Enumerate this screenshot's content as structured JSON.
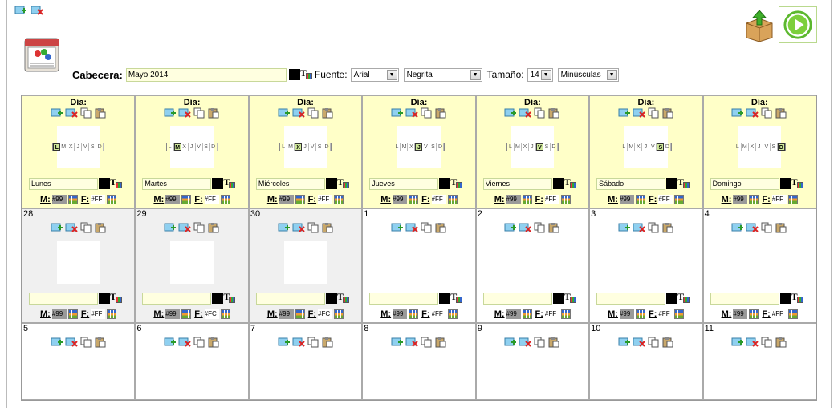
{
  "header": {
    "label": "Cabecera:",
    "value": "Mayo 2014",
    "font_label": "Fuente:",
    "font_family": "Arial",
    "font_weight": "Negrita",
    "size_label": "Tamaño:",
    "size_value": "14",
    "case_value": "Minúsculas"
  },
  "day_header_title": "Día:",
  "weekdays": [
    {
      "name": "Lunes",
      "letter": "L",
      "letters": [
        "L",
        "M",
        "X",
        "J",
        "V",
        "S",
        "D"
      ],
      "pos": 0,
      "m": "#99",
      "f": "#FF"
    },
    {
      "name": "Martes",
      "letter": "M",
      "letters": [
        "L",
        "M",
        "X",
        "J",
        "V",
        "S",
        "D"
      ],
      "pos": 1,
      "m": "#99",
      "f": "#FF"
    },
    {
      "name": "Miércoles",
      "letter": "X",
      "letters": [
        "L",
        "M",
        "X",
        "J",
        "V",
        "S",
        "D"
      ],
      "pos": 2,
      "m": "#99",
      "f": "#FF"
    },
    {
      "name": "Jueves",
      "letter": "J",
      "letters": [
        "L",
        "M",
        "X",
        "J",
        "V",
        "S",
        "D"
      ],
      "pos": 3,
      "m": "#99",
      "f": "#FF"
    },
    {
      "name": "Viernes",
      "letter": "V",
      "letters": [
        "L",
        "M",
        "X",
        "J",
        "V",
        "S",
        "D"
      ],
      "pos": 4,
      "m": "#99",
      "f": "#FF"
    },
    {
      "name": "Sábado",
      "letter": "S",
      "letters": [
        "L",
        "M",
        "X",
        "J",
        "V",
        "S",
        "D"
      ],
      "pos": 5,
      "m": "#99",
      "f": "#FF"
    },
    {
      "name": "Domingo",
      "letter": "D",
      "letters": [
        "L",
        "M",
        "X",
        "J",
        "V",
        "S",
        "D"
      ],
      "pos": 6,
      "m": "#99",
      "f": "#FF"
    }
  ],
  "week1": [
    {
      "num": "28",
      "gray": true,
      "m": "#99",
      "f": "#FF"
    },
    {
      "num": "29",
      "gray": true,
      "m": "#99",
      "f": "#FC"
    },
    {
      "num": "30",
      "gray": true,
      "m": "#99",
      "f": "#FC"
    },
    {
      "num": "1",
      "gray": false,
      "m": "#99",
      "f": "#FF"
    },
    {
      "num": "2",
      "gray": false,
      "m": "#99",
      "f": "#FF"
    },
    {
      "num": "3",
      "gray": false,
      "m": "#99",
      "f": "#FF"
    },
    {
      "num": "4",
      "gray": false,
      "m": "#99",
      "f": "#FF"
    }
  ],
  "week2": [
    {
      "num": "5"
    },
    {
      "num": "6"
    },
    {
      "num": "7"
    },
    {
      "num": "8"
    },
    {
      "num": "9"
    },
    {
      "num": "10"
    },
    {
      "num": "11"
    }
  ],
  "m_label": "M:",
  "f_label": "F:",
  "colors": {
    "header_bg": "#ffffc8",
    "gray_bg": "#f0f0f0",
    "accent_green": "#5cb82e"
  }
}
